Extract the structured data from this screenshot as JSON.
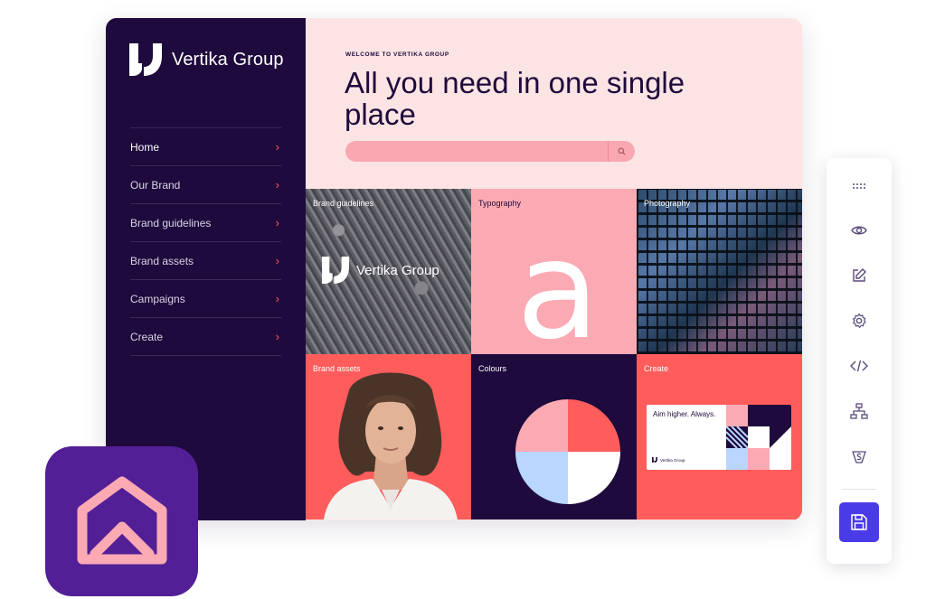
{
  "brand": {
    "name": "Vertika Group",
    "logo_icon": "vertika-u-logo"
  },
  "sidebar": {
    "items": [
      {
        "label": "Home",
        "active": true
      },
      {
        "label": "Our Brand",
        "active": false
      },
      {
        "label": "Brand guidelines",
        "active": false
      },
      {
        "label": "Brand assets",
        "active": false
      },
      {
        "label": "Campaigns",
        "active": false
      },
      {
        "label": "Create",
        "active": false
      }
    ]
  },
  "hero": {
    "eyebrow": "WELCOME TO VERTIKA GROUP",
    "headline": "All you need in one single place",
    "search": {
      "placeholder": "",
      "icon": "search-icon"
    }
  },
  "tiles": [
    {
      "label": "Brand guidelines",
      "overlay_text": "Vertika Group"
    },
    {
      "label": "Typography",
      "glyph": "a"
    },
    {
      "label": "Photography"
    },
    {
      "label": "Brand assets"
    },
    {
      "label": "Colours",
      "swatches": [
        "#ff5c5c",
        "#fbaab4",
        "#b8d6ff",
        "#ffffff"
      ]
    },
    {
      "label": "Create",
      "card_text": "Aim higher. Always.",
      "card_brand": "Vertika Group"
    }
  ],
  "toolbar": {
    "items": [
      "drag-handle-icon",
      "eye-icon",
      "edit-icon",
      "settings-icon",
      "code-icon",
      "sitemap-icon",
      "badge-s-icon"
    ],
    "primary": "save-icon"
  },
  "colors": {
    "navy": "#1e0a3c",
    "coral": "#ff5c5c",
    "pink": "#fbaab4",
    "hero_bg": "#fde4e4",
    "save_button": "#4a3be8",
    "app_icon_bg": "#531f97"
  }
}
